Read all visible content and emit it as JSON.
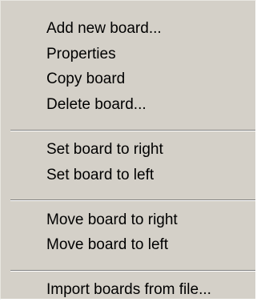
{
  "menu": {
    "items": [
      {
        "label": "Add new board..."
      },
      {
        "label": "Properties"
      },
      {
        "label": "Copy board"
      },
      {
        "label": "Delete board..."
      },
      {
        "label": "Set board to right"
      },
      {
        "label": "Set board to left"
      },
      {
        "label": "Move board to right"
      },
      {
        "label": "Move board to left"
      },
      {
        "label": "Import boards from file..."
      }
    ]
  }
}
